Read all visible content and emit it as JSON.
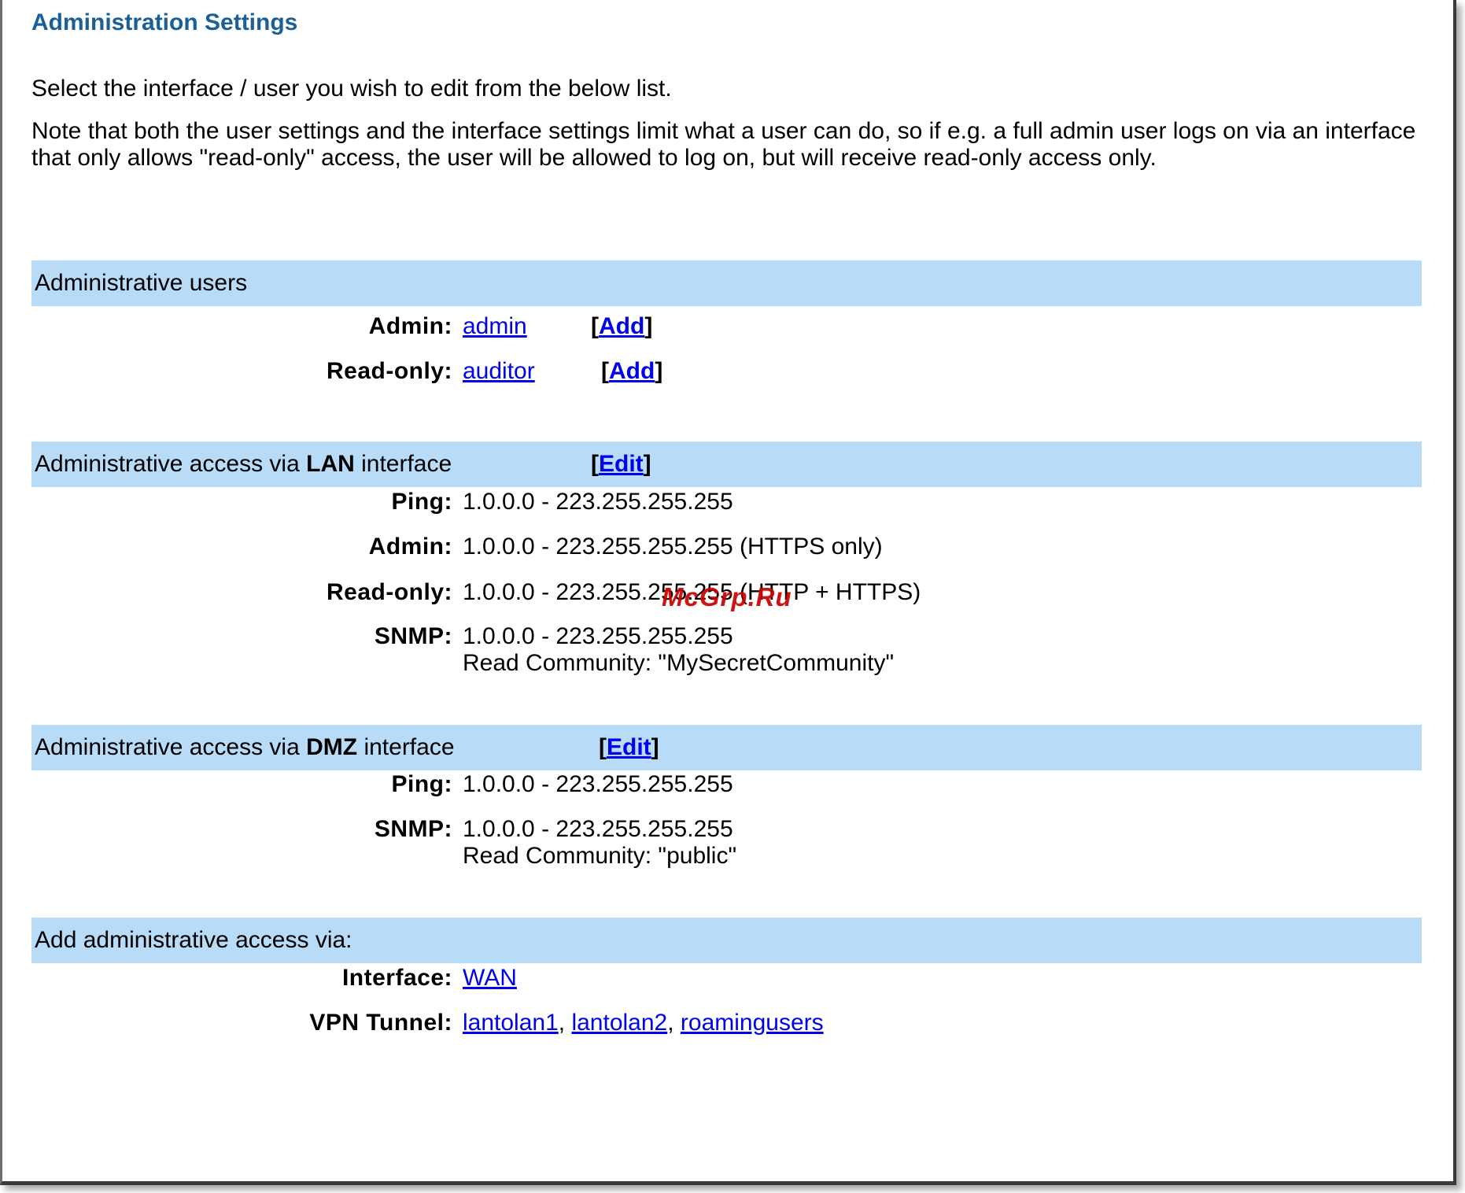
{
  "title": "Administration Settings",
  "intro": "Select the interface / user you wish to edit from the below list.",
  "note": "Note that both the user settings and the interface settings limit what a user can do, so if e.g. a full admin user logs on via an interface that only allows \"read-only\" access, the user will be allowed to log on, but will receive read-only access only.",
  "users_section": {
    "header": "Administrative users",
    "admin_label": "Admin:",
    "admin_user": "admin",
    "readonly_label": "Read-only:",
    "readonly_user": "auditor",
    "add_open": "[",
    "add_label": "Add",
    "add_close": "]"
  },
  "lan_section": {
    "header_prefix": "Administrative access via ",
    "header_bold": "LAN",
    "header_suffix": " interface",
    "edit_label": "Edit",
    "ping_label": "Ping:",
    "ping_value": "1.0.0.0 - 223.255.255.255",
    "admin_label": "Admin:",
    "admin_value": "1.0.0.0 - 223.255.255.255 (HTTPS only)",
    "readonly_label": "Read-only:",
    "readonly_value": "1.0.0.0 - 223.255.255.255 (HTTP + HTTPS)",
    "snmp_label": "SNMP:",
    "snmp_value": "1.0.0.0 - 223.255.255.255",
    "snmp_community": "Read Community: \"MySecretCommunity\""
  },
  "dmz_section": {
    "header_prefix": "Administrative access via ",
    "header_bold": "DMZ",
    "header_suffix": " interface",
    "edit_label": "Edit",
    "ping_label": "Ping:",
    "ping_value": "1.0.0.0 - 223.255.255.255",
    "snmp_label": "SNMP:",
    "snmp_value": "1.0.0.0 - 223.255.255.255",
    "snmp_community": "Read Community: \"public\""
  },
  "add_section": {
    "header": "Add administrative access via:",
    "interface_label": "Interface:",
    "interface_link": "WAN",
    "vpn_label": "VPN Tunnel:",
    "vpn_links": [
      "lantolan1",
      "lantolan2",
      "roamingusers"
    ],
    "separator": ", "
  },
  "watermark": "McGrp.Ru",
  "colors": {
    "title": "#1a5f96",
    "section_bar": "#b8dcf7",
    "link": "#0000ee",
    "watermark": "#cc0000"
  }
}
